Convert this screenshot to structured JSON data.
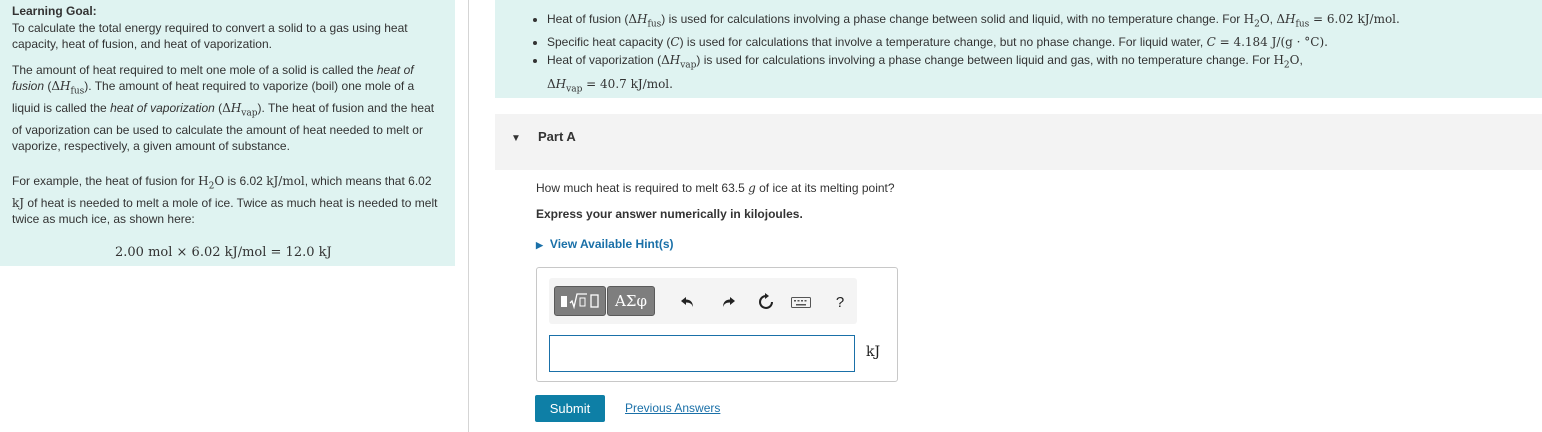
{
  "learning_goal": {
    "title": "Learning Goal:",
    "intro": "To calculate the total energy required to convert a solid to a gas using heat capacity, heat of fusion, and heat of vaporization.",
    "p2_a": "The amount of heat required to melt one mole of a solid is called the ",
    "p2_term1": "heat of fusion",
    "p2_b": " (",
    "p2_c": "). The amount of heat required to vaporize (boil) one mole of a liquid is called the ",
    "p2_term2": "heat of vaporization",
    "p2_d": " (",
    "p2_e": "). The heat of fusion and the heat of vaporization can be used to calculate the amount of heat needed to melt or vaporize, respectively, a given amount of substance.",
    "p3_a": "For example, the heat of fusion for ",
    "p3_b": " is 6.02 ",
    "p3_c": ", which means that 6.02 ",
    "p3_d": " of heat is needed to melt a mole of ice. Twice as much heat is needed to melt twice as much ice, as shown here:",
    "equation": "2.00 mol × 6.02 kJ/mol = 12.0 kJ"
  },
  "math": {
    "delta": "Δ",
    "H": "H",
    "fus": "fus",
    "vap": "vap",
    "h2o_H": "H",
    "h2o_2": "2",
    "h2o_O": "O",
    "kj_per_mol": "kJ/mol",
    "kj": "kJ"
  },
  "info": {
    "b1_a": "Heat of fusion (",
    "b1_b": ") is used for calculations involving a phase change between solid and liquid, with no temperature change. For ",
    "b1_c": ", ",
    "b1_d": " = 6.02 kJ/mol.",
    "b2_a": "Specific heat capacity (",
    "b2_C": "C",
    "b2_b": ") is used for calculations that involve a temperature change, but no phase change. For liquid water, ",
    "b2_c": " = 4.184 J/(g · °C).",
    "b3_a": "Heat of vaporization (",
    "b3_b": ") is used for calculations involving a phase change between liquid and gas, with no temperature change. For ",
    "b3_c": ",",
    "b3_d": " = 40.7 kJ/mol."
  },
  "part": {
    "label": "Part A",
    "question_a": "How much heat is required to melt 63.5 ",
    "question_g": "g",
    "question_b": " of ice at its melting point?",
    "instruction": "Express your answer numerically in kilojoules.",
    "hints": "View Available Hint(s)"
  },
  "toolbar": {
    "symbols_label": "ΑΣφ",
    "help_label": "?",
    "icons": [
      "templates-icon",
      "undo-icon",
      "redo-icon",
      "reset-icon",
      "keyboard-icon",
      "help-icon"
    ]
  },
  "answer": {
    "value": "",
    "unit": "kJ"
  },
  "actions": {
    "submit": "Submit",
    "previous": "Previous Answers"
  },
  "colors": {
    "panel_bg": "#dff3f1",
    "link": "#1a70a8",
    "submit_bg": "#0e7fa6"
  }
}
